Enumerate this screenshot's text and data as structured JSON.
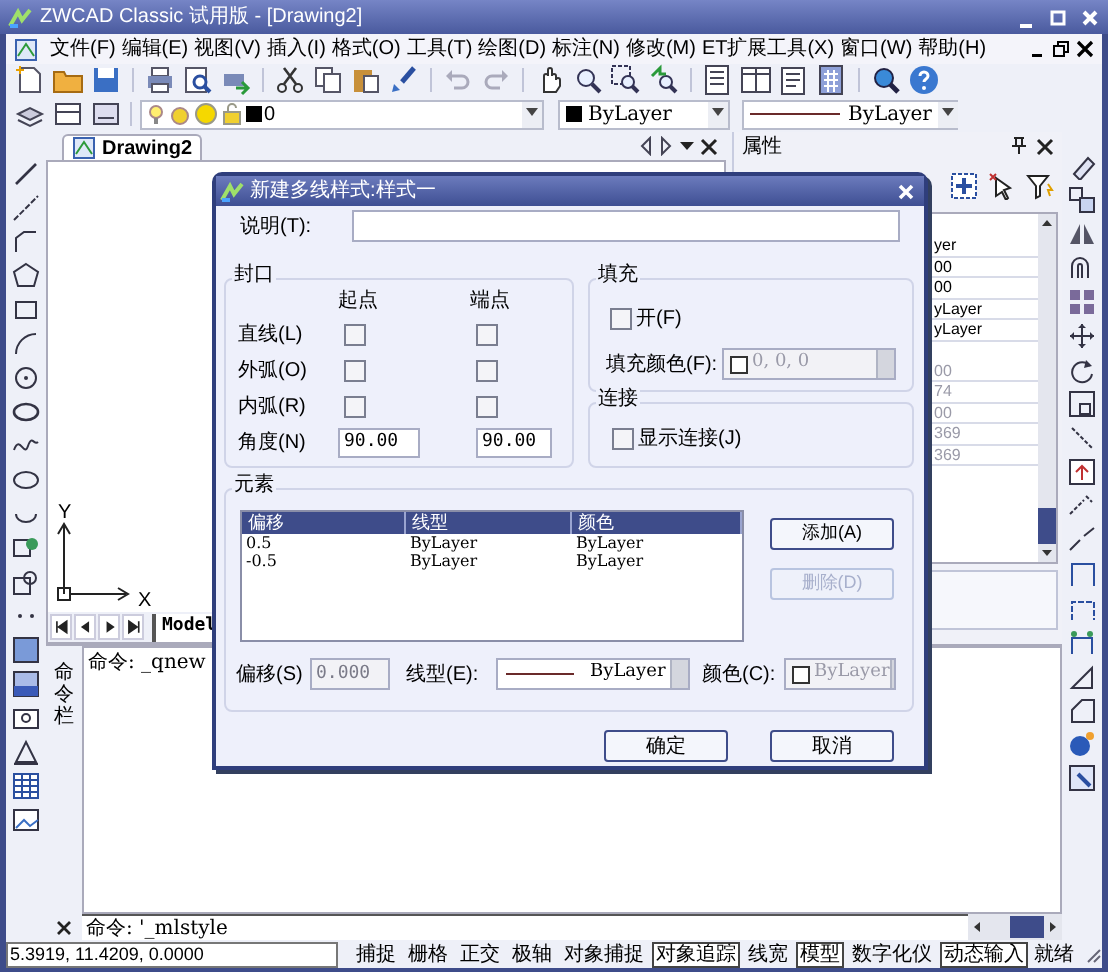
{
  "window": {
    "title": "ZWCAD Classic 试用版 - [Drawing2]"
  },
  "menu": [
    "文件(F)",
    "编辑(E)",
    "视图(V)",
    "插入(I)",
    "格式(O)",
    "工具(T)",
    "绘图(D)",
    "标注(N)",
    "修改(M)",
    "ET扩展工具(X)",
    "窗口(W)",
    "帮助(H)"
  ],
  "layer_toolbar": {
    "layer": "0",
    "color_setting": "ByLayer",
    "linetype": "ByLayer"
  },
  "document_tab": {
    "label": "Drawing2"
  },
  "canvas": {
    "axis_y": "Y",
    "axis_x": "X",
    "layout_tab": "Model"
  },
  "properties_panel": {
    "title": "属性",
    "rows": [
      {
        "value": "yer",
        "disabled": false
      },
      {
        "value": "00",
        "disabled": false
      },
      {
        "value": "00",
        "disabled": false
      },
      {
        "value": "yLayer",
        "disabled": false
      },
      {
        "value": "yLayer",
        "disabled": false
      },
      {
        "value": "00",
        "disabled": true
      },
      {
        "value": "74",
        "disabled": true
      },
      {
        "value": "00",
        "disabled": true
      },
      {
        "value": "369",
        "disabled": true
      },
      {
        "value": "369",
        "disabled": true
      }
    ]
  },
  "command_window": {
    "title": "命令栏",
    "history": [
      "命令: _qnew"
    ],
    "prompt": "命令: '_mlstyle"
  },
  "status_bar": {
    "coordinates": "5.3919, 11.4209, 0.0000",
    "toggles": [
      {
        "label": "捕捉",
        "on": false
      },
      {
        "label": "栅格",
        "on": false
      },
      {
        "label": "正交",
        "on": false
      },
      {
        "label": "极轴",
        "on": false
      },
      {
        "label": "对象捕捉",
        "on": false
      },
      {
        "label": "对象追踪",
        "on": true
      },
      {
        "label": "线宽",
        "on": false
      },
      {
        "label": "模型",
        "on": true
      },
      {
        "label": "数字化仪",
        "on": false
      },
      {
        "label": "动态输入",
        "on": true
      }
    ],
    "state": "就绪"
  },
  "dialog": {
    "title": "新建多线样式:样式一",
    "description_label": "说明(T):",
    "caps": {
      "title": "封口",
      "columns": [
        "起点",
        "端点"
      ],
      "rows": [
        {
          "label": "直线(L)",
          "start": false,
          "end": false
        },
        {
          "label": "外弧(O)",
          "start": false,
          "end": false
        },
        {
          "label": "内弧(R)",
          "start": false,
          "end": false
        }
      ],
      "angle": {
        "label": "角度(N)",
        "start": "90.00",
        "end": "90.00"
      }
    },
    "fill": {
      "title": "填充",
      "on": {
        "label": "开(F)",
        "checked": false
      },
      "color": {
        "label": "填充颜色(F):",
        "value": "0, 0, 0",
        "disabled": true
      }
    },
    "joints": {
      "title": "连接",
      "show": {
        "label": "显示连接(J)",
        "checked": false
      }
    },
    "elements": {
      "title": "元素",
      "columns": [
        "偏移",
        "线型",
        "颜色"
      ],
      "rows": [
        [
          "0.5",
          "ByLayer",
          "ByLayer"
        ],
        [
          "-0.5",
          "ByLayer",
          "ByLayer"
        ]
      ],
      "buttons": [
        {
          "label": "添加(A)",
          "disabled": false
        },
        {
          "label": "删除(D)",
          "disabled": true
        }
      ],
      "offset": {
        "label": "偏移(S)",
        "value": "0.000",
        "disabled": true
      },
      "linetype": {
        "label": "线型(E):",
        "value": "ByLayer"
      },
      "color": {
        "label": "颜色(C):",
        "value": "ByLayer",
        "disabled": true
      }
    },
    "buttons": [
      "确定",
      "取消"
    ]
  }
}
